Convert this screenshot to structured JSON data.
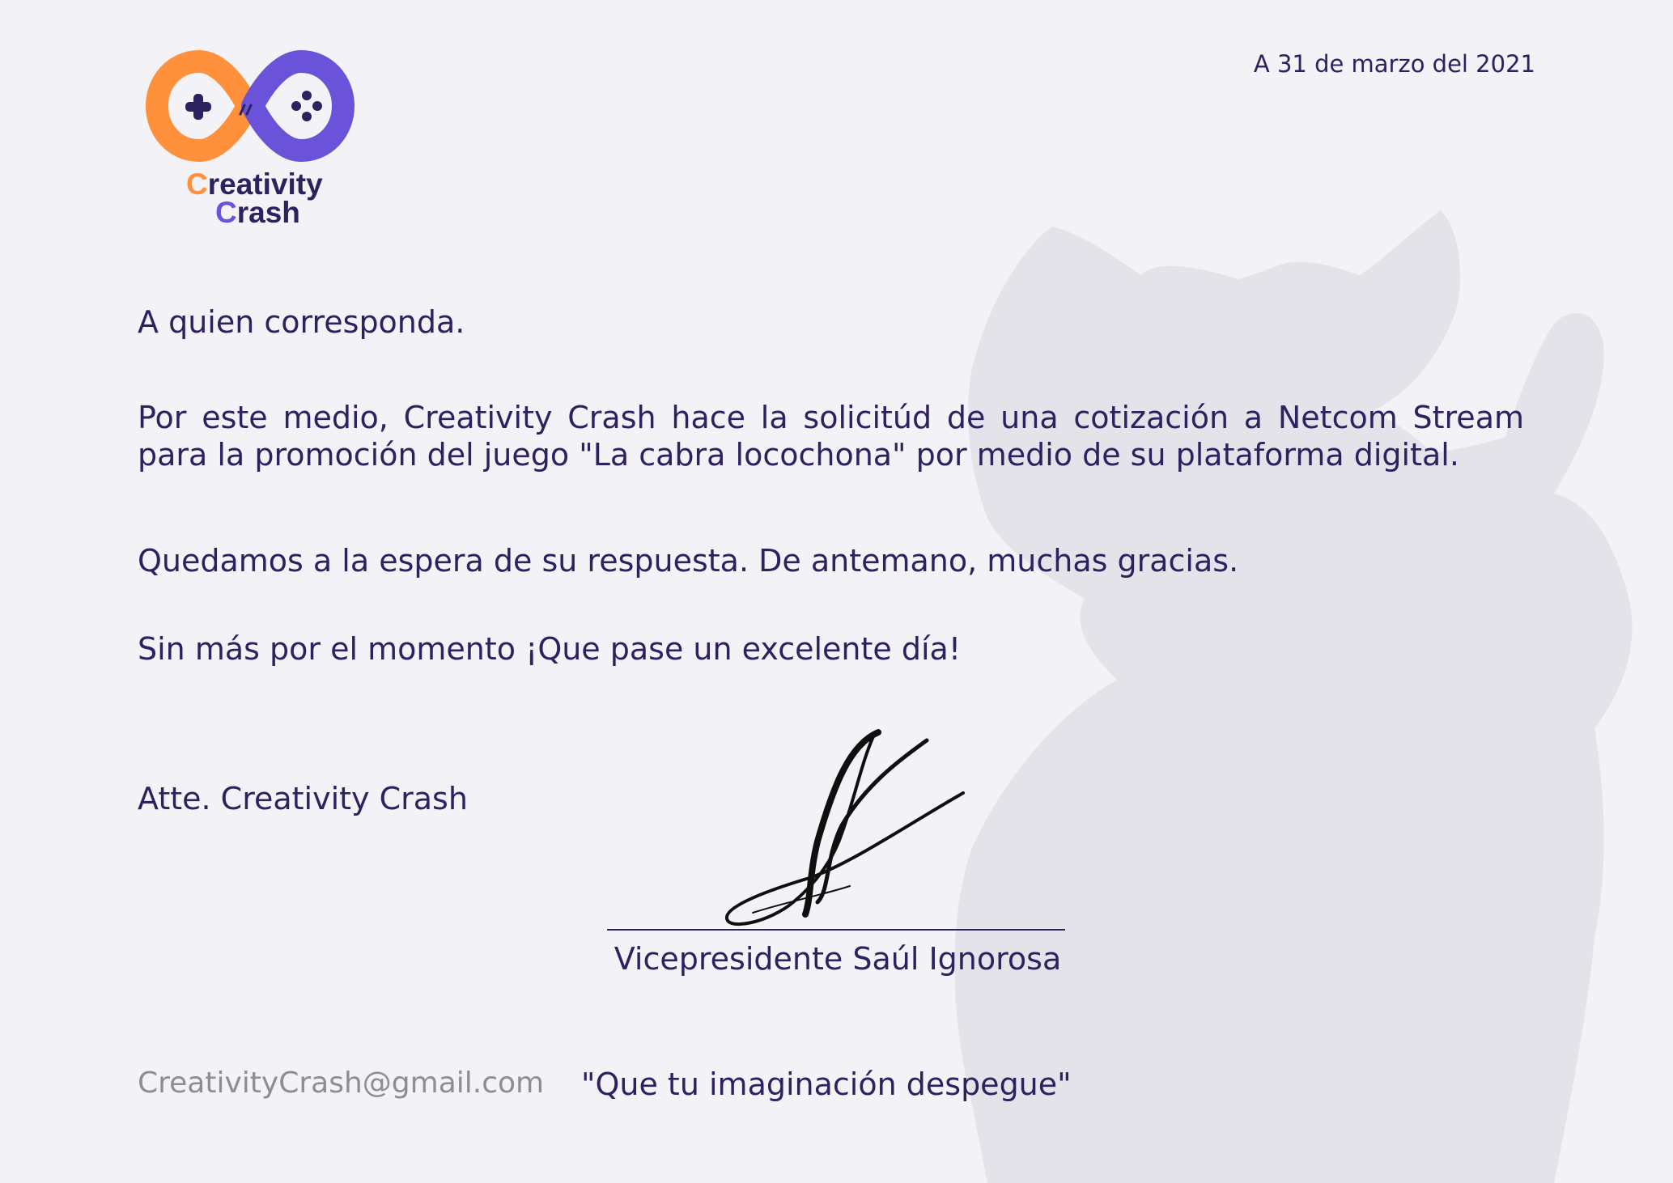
{
  "brand": {
    "name_line1_initial": "C",
    "name_line1_rest": "reativity",
    "name_line2_initial": "C",
    "name_line2_rest": "rash",
    "colors": {
      "orange": "#ff913c",
      "purple": "#6a52d9",
      "navy": "#2a2360"
    }
  },
  "letter": {
    "date": "A 31 de marzo del 2021",
    "salutation": "A quien corresponda.",
    "paragraphs": [
      "Por este medio, Creativity Crash hace la solicitúd de una cotización a Netcom Stream para la promoción del juego \"La cabra locochona\" por medio de su plataforma digital.",
      "Quedamos a la espera de su respuesta. De antemano, muchas gracias.",
      "Sin más por el momento ¡Que pase un excelente día!"
    ],
    "sign_off": "Atte. Creativity Crash",
    "signer": "Vicepresidente Saúl Ignorosa"
  },
  "footer": {
    "email": "CreativityCrash@gmail.com",
    "slogan": "\"Que tu imaginación despegue\""
  },
  "icons": [
    "gamepad-infinity-logo-icon",
    "cat-silhouette-watermark-icon",
    "handwritten-signature-icon"
  ]
}
